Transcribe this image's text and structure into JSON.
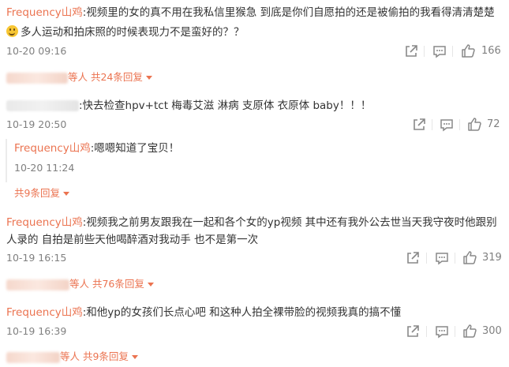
{
  "comments": [
    {
      "user": "Frequency山鸡",
      "text_line1": ":视频里的女的真不用在我私信里猴急 到底是你们自愿拍的还是被偷拍的我看得清清楚楚",
      "text_line2": "多人运动和拍床照的时候表现力不是蛮好的？？",
      "time": "10-20 09:16",
      "likes": "166",
      "replies_summary": "等人 共24条回复"
    },
    {
      "user": "",
      "text": ":快去检查hpv+tct 梅毒艾滋 淋病 支原体 衣原体 baby！！！",
      "time": "10-19 20:50",
      "likes": "72",
      "sub_reply": {
        "user": "Frequency山鸡",
        "text": ":嗯嗯知道了宝贝！",
        "time": "10-20 11:24"
      },
      "replies_summary": "共9条回复"
    },
    {
      "user": "Frequency山鸡",
      "text_line1": ":视频我之前男友跟我在一起和各个女的yp视频 其中还有我外公去世当天我守夜时他跟别",
      "text_line2": "人录的 自拍是前些天他喝醉酒对我动手 也不是第一次",
      "time": "10-19 16:15",
      "likes": "319",
      "replies_summary": "等人 共76条回复"
    },
    {
      "user": "Frequency山鸡",
      "text": ":和他yp的女孩们长点心吧 和这种人拍全裸带脸的视频我真的搞不懂",
      "time": "10-19 16:39",
      "likes": "300",
      "replies_summary": "等人 共9条回复"
    }
  ],
  "icons": {
    "share": "share-icon",
    "comment": "comment-icon",
    "like": "thumbs-up-icon",
    "expand": "triangle-down-icon",
    "emoji": "smile-emoji-icon"
  },
  "colors": {
    "username": "#eb7350",
    "text": "#333333",
    "meta": "#808080"
  }
}
